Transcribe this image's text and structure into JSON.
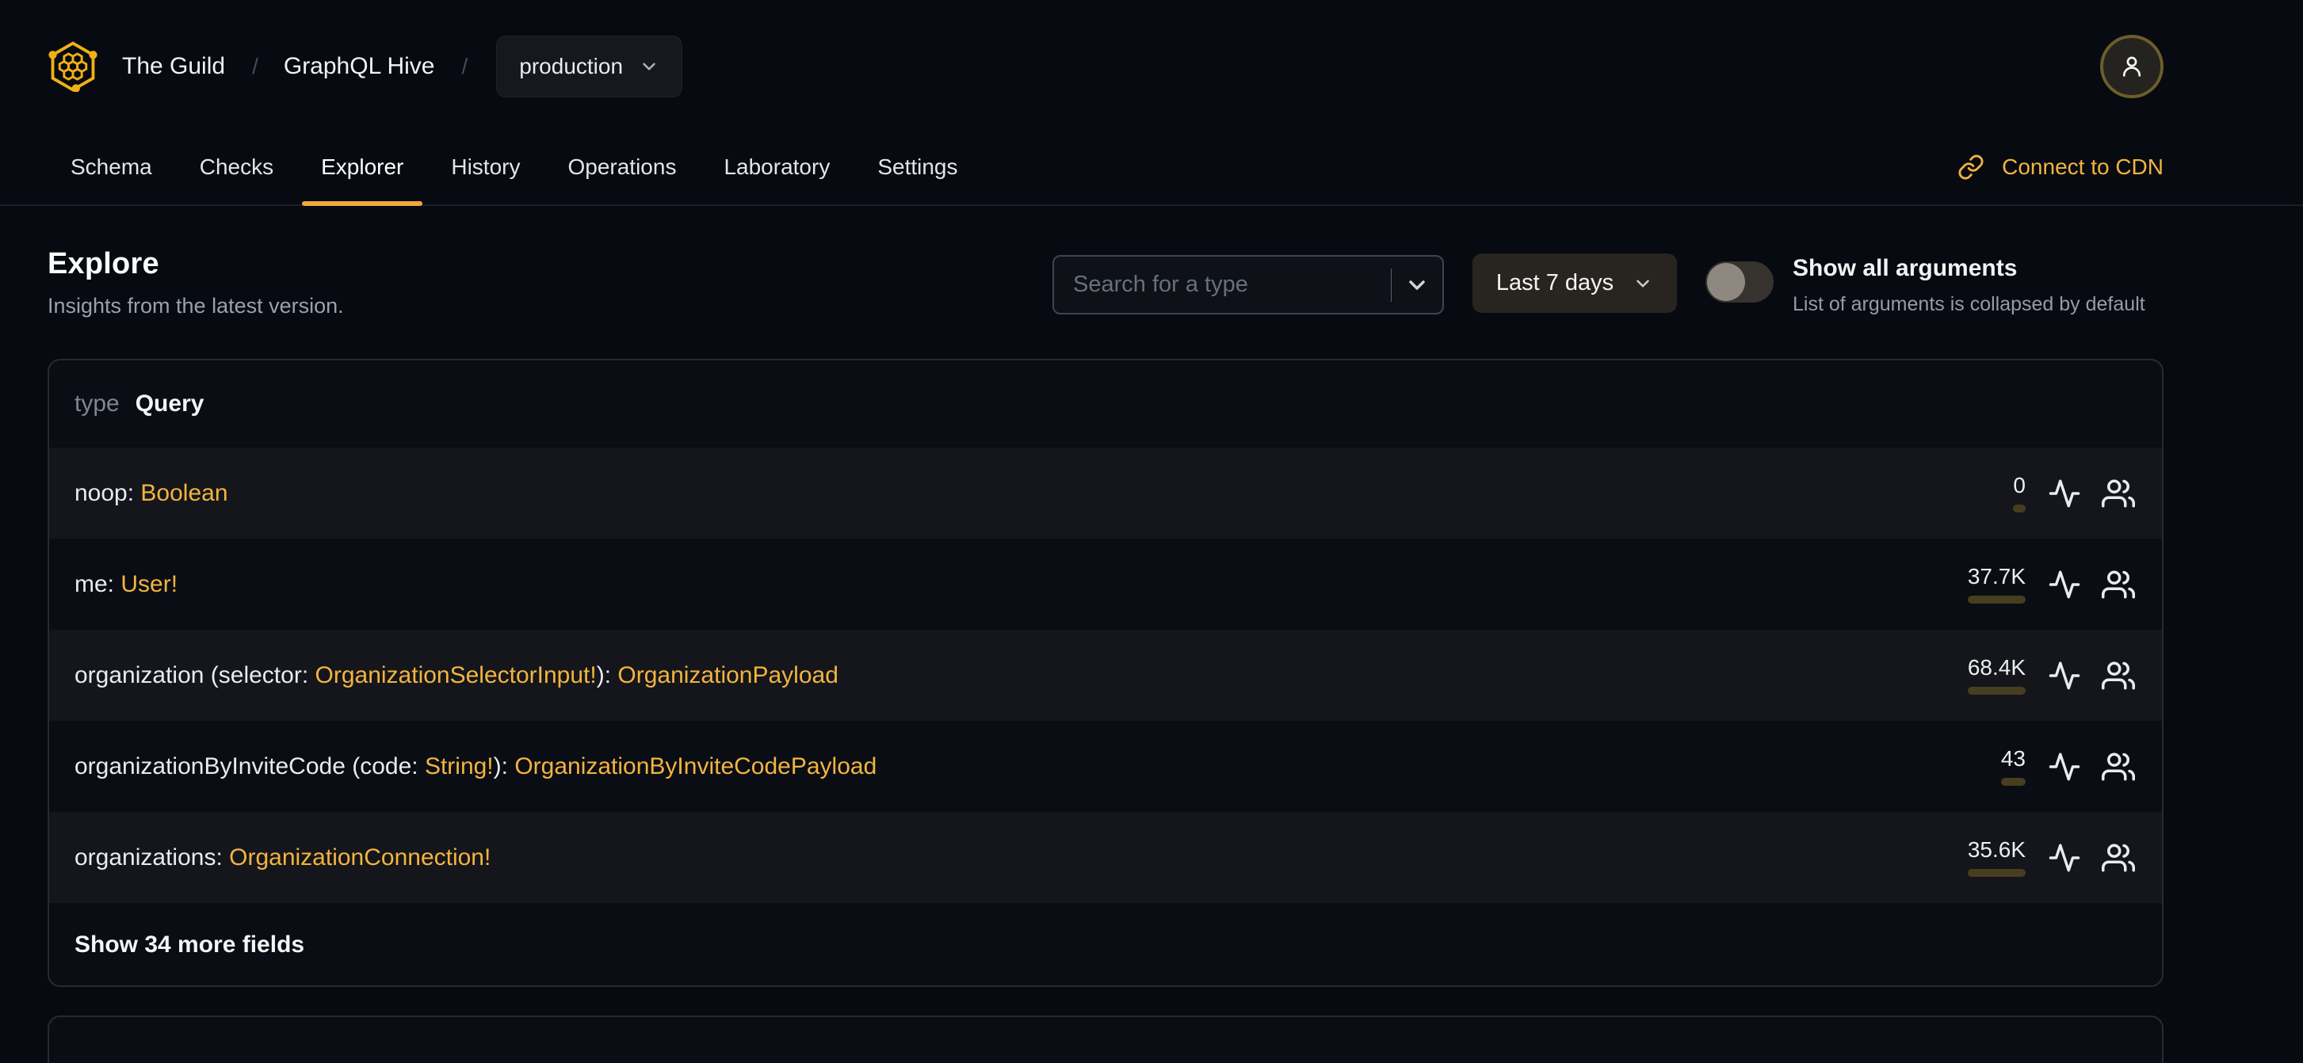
{
  "header": {
    "breadcrumb": {
      "separator": "/",
      "org": "The Guild",
      "project": "GraphQL Hive",
      "target": "production"
    },
    "tabs": [
      {
        "label": "Schema",
        "active": false
      },
      {
        "label": "Checks",
        "active": false
      },
      {
        "label": "Explorer",
        "active": true
      },
      {
        "label": "History",
        "active": false
      },
      {
        "label": "Operations",
        "active": false
      },
      {
        "label": "Laboratory",
        "active": false
      },
      {
        "label": "Settings",
        "active": false
      }
    ],
    "cdn_link_label": "Connect to CDN"
  },
  "page": {
    "title": "Explore",
    "subtitle": "Insights from the latest version."
  },
  "controls": {
    "search_placeholder": "Search for a type",
    "period_label": "Last 7 days",
    "toggle_title": "Show all arguments",
    "toggle_hint": "List of arguments is collapsed by default",
    "toggle_state": "off"
  },
  "type_card": {
    "kind_label": "type",
    "type_name": "Query",
    "fields": [
      {
        "p1": "noop: ",
        "t1": "Boolean",
        "p2": "",
        "t2": "",
        "count": "0",
        "fill": "0%"
      },
      {
        "p1": "me: ",
        "t1": "User!",
        "p2": "",
        "t2": "",
        "count": "37.7K",
        "fill": "30%"
      },
      {
        "p1": "organization (selector: ",
        "t1": "OrganizationSelectorInput!",
        "p2": "): ",
        "t2": "OrganizationPayload",
        "count": "68.4K",
        "fill": "30%"
      },
      {
        "p1": "organizationByInviteCode (code: ",
        "t1": "String!",
        "p2": "): ",
        "t2": "OrganizationByInviteCodePayload",
        "count": "43",
        "fill": "0%"
      },
      {
        "p1": "organizations: ",
        "t1": "OrganizationConnection!",
        "p2": "",
        "t2": "",
        "count": "35.6K",
        "fill": "22%"
      }
    ],
    "show_more_label": "Show 34 more fields"
  },
  "icons": {
    "logo": "hive-honeycomb-icon",
    "avatar": "user-icon",
    "cdn": "link-icon",
    "dropdowns": "chevron-down-icon",
    "per_field": [
      "activity-icon",
      "users-icon"
    ]
  },
  "colors": {
    "accent_amber": "#f3b43f",
    "tab_underline": "#f0a73c",
    "bar_fill": "#f0b23d",
    "bar_track": "#473e20",
    "page_bg": "#070a10",
    "row_alt_bg": "#14161b",
    "muted_text": "#99a1ab"
  }
}
